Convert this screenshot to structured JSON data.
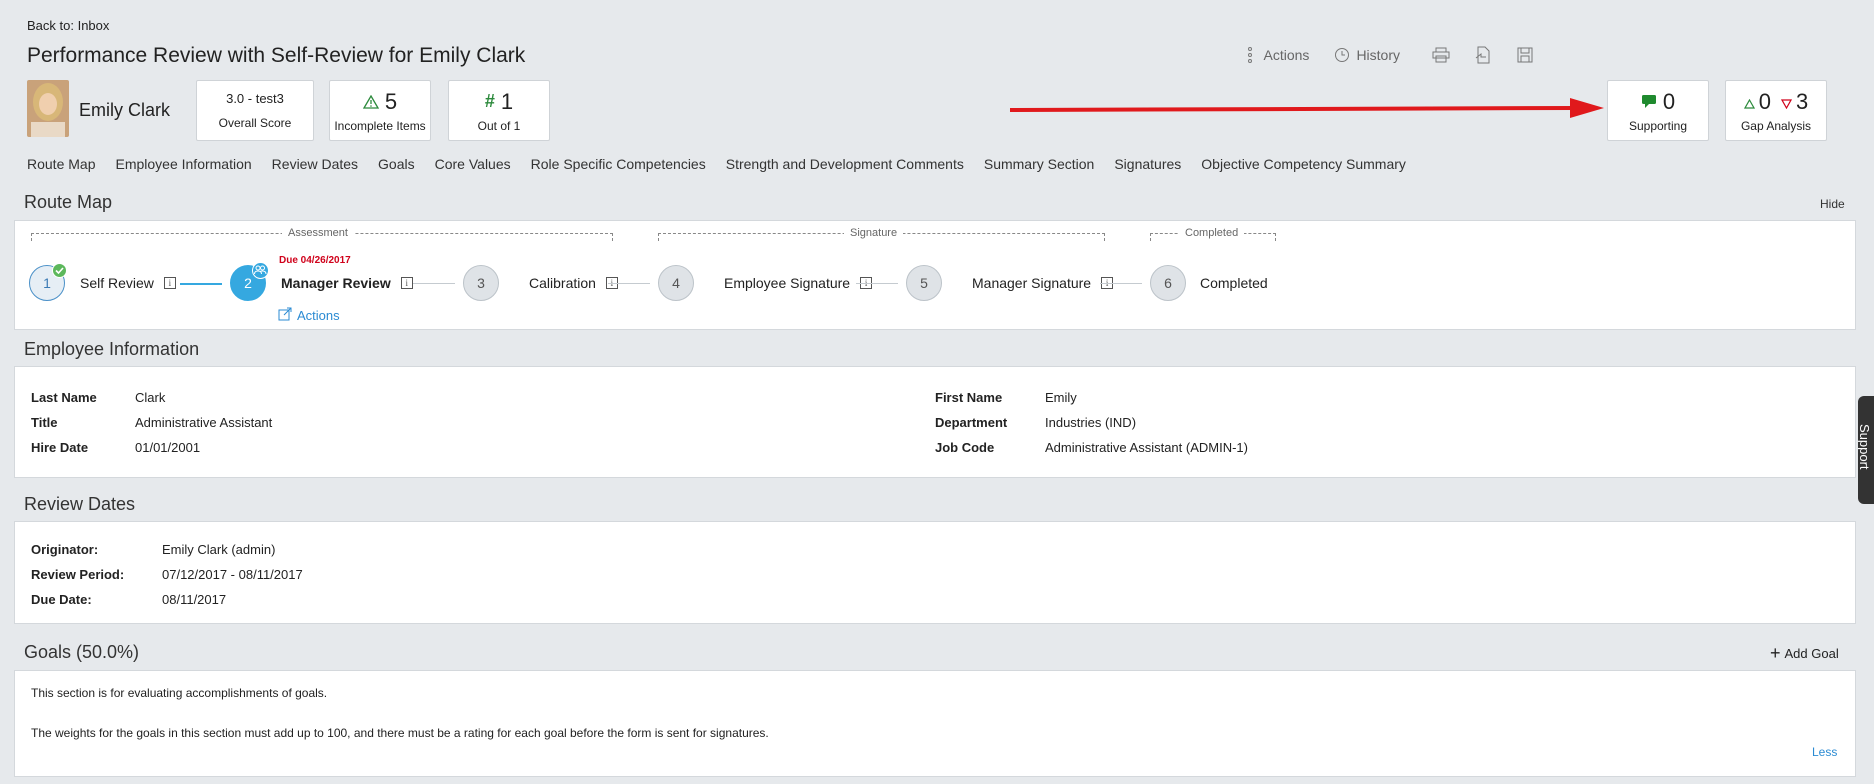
{
  "header": {
    "back_link": "Back to: Inbox",
    "title": "Performance Review with Self-Review for Emily Clark",
    "toolbar": {
      "actions": "Actions",
      "history": "History"
    }
  },
  "user": {
    "name": "Emily Clark"
  },
  "summary_cards": {
    "score": {
      "value": "3.0 - test3",
      "label": "Overall Score"
    },
    "incomplete": {
      "value": "5",
      "label": "Incomplete Items"
    },
    "rank": {
      "value": "1",
      "label": "Out of 1"
    },
    "supporting": {
      "value": "0",
      "label": "Supporting"
    },
    "gap": {
      "up_value": "0",
      "down_value": "3",
      "label": "Gap Analysis"
    }
  },
  "nav": [
    "Route Map",
    "Employee Information",
    "Review Dates",
    "Goals",
    "Core Values",
    "Role Specific Competencies",
    "Strength and Development Comments",
    "Summary Section",
    "Signatures",
    "Objective Competency Summary"
  ],
  "route_map": {
    "title": "Route Map",
    "hide": "Hide",
    "groups": {
      "assessment": "Assessment",
      "signature": "Signature",
      "completed": "Completed"
    },
    "due": "Due 04/26/2017",
    "actions": "Actions",
    "steps": [
      {
        "num": "1",
        "label": "Self Review"
      },
      {
        "num": "2",
        "label": "Manager Review"
      },
      {
        "num": "3",
        "label": "Calibration"
      },
      {
        "num": "4",
        "label": "Employee Signature"
      },
      {
        "num": "5",
        "label": "Manager Signature"
      },
      {
        "num": "6",
        "label": "Completed"
      }
    ]
  },
  "employee_info": {
    "title": "Employee Information",
    "left": [
      {
        "label": "Last Name",
        "value": "Clark"
      },
      {
        "label": "Title",
        "value": "Administrative Assistant"
      },
      {
        "label": "Hire Date",
        "value": "01/01/2001"
      }
    ],
    "right": [
      {
        "label": "First Name",
        "value": "Emily"
      },
      {
        "label": "Department",
        "value": "Industries (IND)"
      },
      {
        "label": "Job Code",
        "value": "Administrative Assistant (ADMIN-1)"
      }
    ]
  },
  "review_dates": {
    "title": "Review Dates",
    "rows": [
      {
        "label": "Originator:",
        "value": "Emily Clark (admin)"
      },
      {
        "label": "Review Period:",
        "value": "07/12/2017 - 08/11/2017"
      },
      {
        "label": "Due Date:",
        "value": "08/11/2017"
      }
    ]
  },
  "goals": {
    "title": "Goals (50.0%)",
    "add": "Add Goal",
    "line1": "This section is for evaluating accomplishments of goals.",
    "line2": "The weights for the goals in this section must add up to 100, and there must be a rating for each goal before the form is sent for signatures.",
    "less": "Less"
  },
  "support_tab": "Support",
  "colors": {
    "accent": "#35a8e0",
    "link": "#2b8bd3",
    "arrow": "#e0191c",
    "due": "#d0021b",
    "supporting_icon": "#1f8a2e"
  }
}
